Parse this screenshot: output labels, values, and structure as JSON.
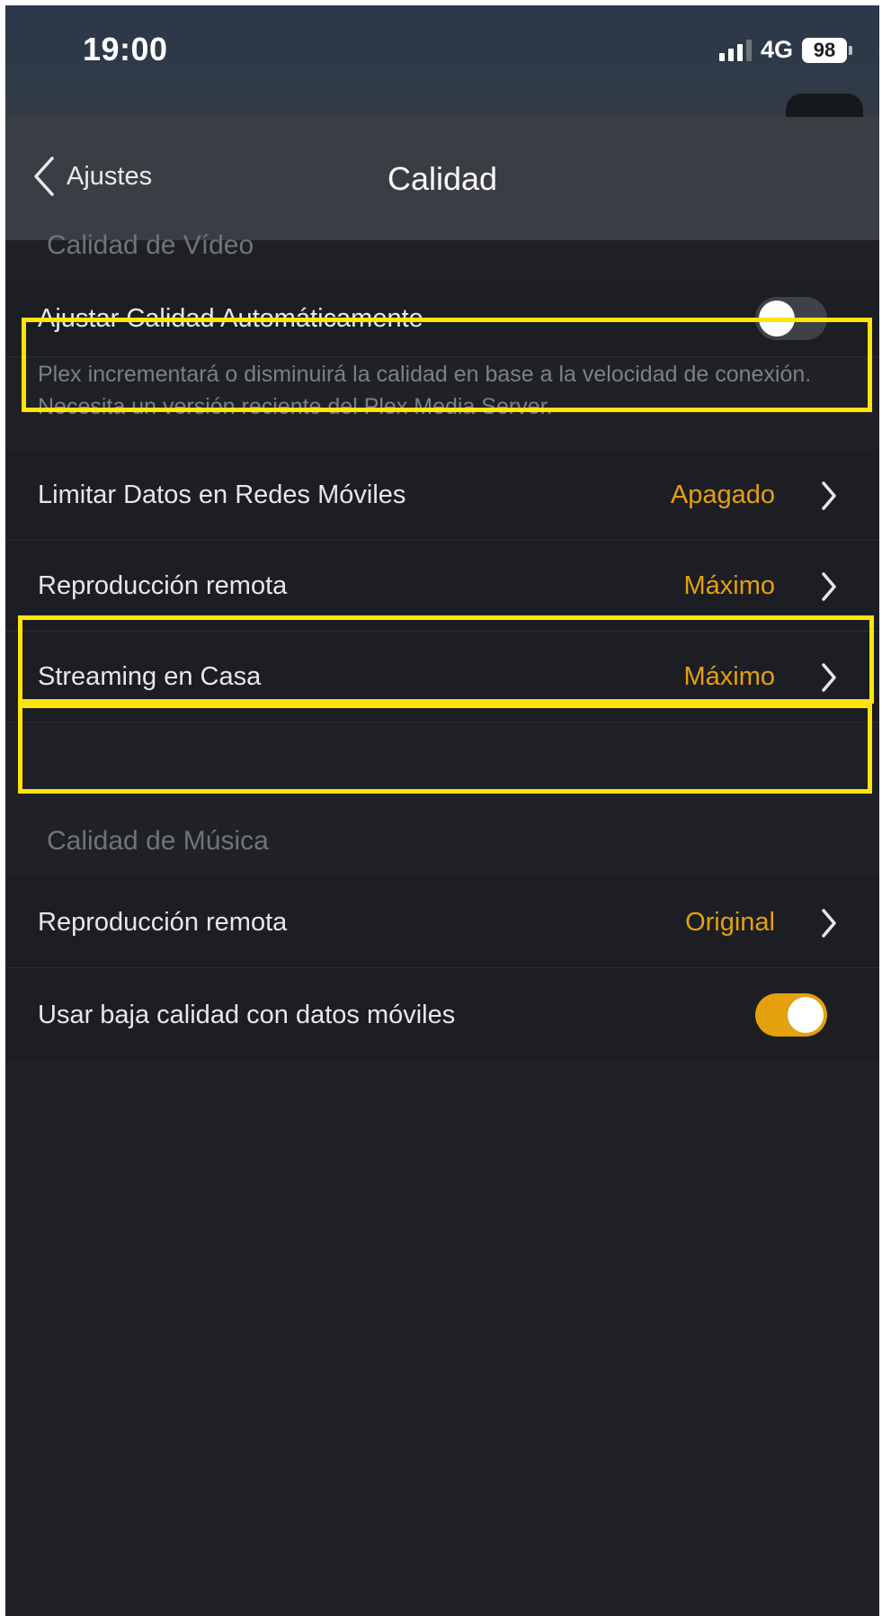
{
  "status_bar": {
    "time": "19:00",
    "network": "4G",
    "battery": "98",
    "signal_icon": "cellular-signal-icon",
    "battery_icon": "battery-icon"
  },
  "nav": {
    "back_label": "Ajustes",
    "back_icon": "chevron-left-icon",
    "title": "Calidad"
  },
  "video_section": {
    "header": "Calidad de Vídeo",
    "auto_quality": {
      "label": "Ajustar Calidad Automáticamente",
      "enabled": false,
      "description": "Plex incrementará o disminuirá la calidad en base a la velocidad de conexión. Necesita un versión reciente del Plex Media Server."
    },
    "rows": [
      {
        "label": "Limitar Datos en Redes Móviles",
        "value": "Apagado"
      },
      {
        "label": "Reproducción remota",
        "value": "Máximo"
      },
      {
        "label": "Streaming en Casa",
        "value": "Máximo"
      }
    ]
  },
  "music_section": {
    "header": "Calidad de Música",
    "remote": {
      "label": "Reproducción remota",
      "value": "Original"
    },
    "low_quality_mobile": {
      "label": "Usar baja calidad con datos móviles",
      "enabled": true
    }
  },
  "colors": {
    "accent": "#e5a00d",
    "highlight": "#ffe40a",
    "background": "#1f2126",
    "nav_background": "#3a3d43"
  }
}
